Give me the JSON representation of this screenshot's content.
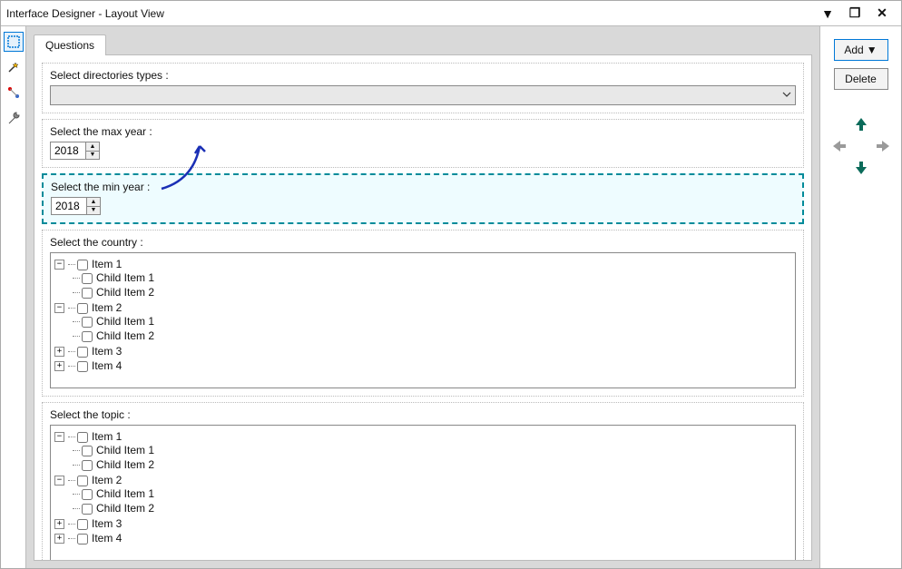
{
  "window": {
    "title": "Interface Designer - Layout View"
  },
  "tabs": [
    {
      "label": "Questions"
    }
  ],
  "actions": {
    "add": "Add",
    "delete": "Delete"
  },
  "fields": {
    "directories": {
      "label": "Select directories types :"
    },
    "max_year": {
      "label": "Select the max year :",
      "value": "2018"
    },
    "min_year": {
      "label": "Select the min year :",
      "value": "2018"
    },
    "country": {
      "label": "Select the country :",
      "tree": [
        {
          "label": "Item 1",
          "expanded": true,
          "children": [
            {
              "label": "Child Item 1"
            },
            {
              "label": "Child Item 2"
            }
          ]
        },
        {
          "label": "Item 2",
          "expanded": true,
          "children": [
            {
              "label": "Child Item 1"
            },
            {
              "label": "Child Item 2"
            }
          ]
        },
        {
          "label": "Item 3",
          "expanded": false,
          "children": []
        },
        {
          "label": "Item 4",
          "expanded": false,
          "children": []
        }
      ]
    },
    "topic": {
      "label": "Select the topic :",
      "tree": [
        {
          "label": "Item 1",
          "expanded": true,
          "children": [
            {
              "label": "Child Item 1"
            },
            {
              "label": "Child Item 2"
            }
          ]
        },
        {
          "label": "Item 2",
          "expanded": true,
          "children": [
            {
              "label": "Child Item 1"
            },
            {
              "label": "Child Item 2"
            }
          ]
        },
        {
          "label": "Item 3",
          "expanded": false,
          "children": []
        },
        {
          "label": "Item 4",
          "expanded": false,
          "children": []
        }
      ]
    }
  }
}
